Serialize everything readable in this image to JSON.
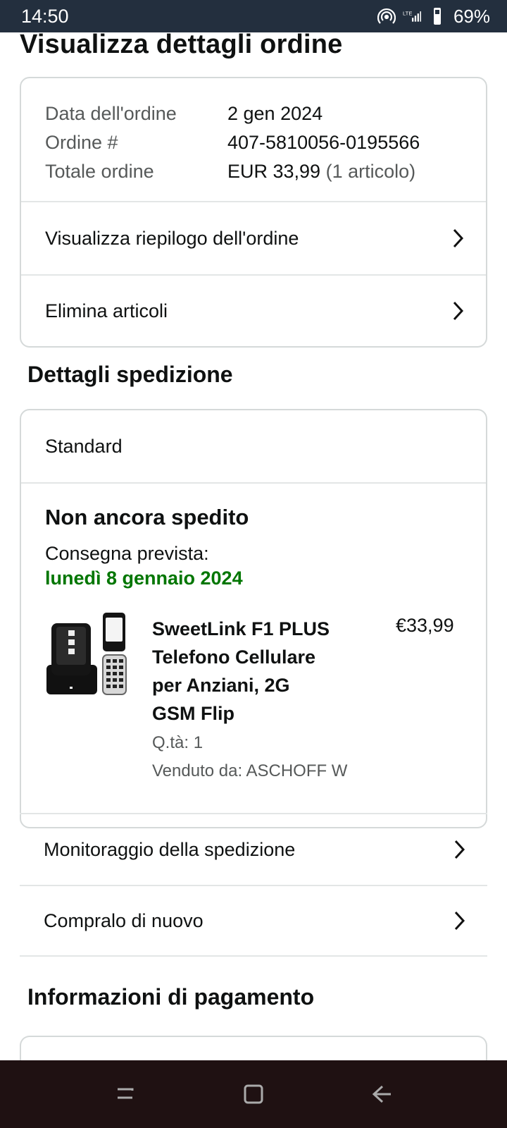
{
  "status_bar": {
    "time": "14:50",
    "battery": "69%",
    "icons": [
      "hotspot-icon",
      "lte-signal-icon",
      "battery-icon"
    ]
  },
  "page": {
    "title": "Visualizza dettagli ordine"
  },
  "order": {
    "date_label": "Data dell'ordine",
    "date_value": "2 gen 2024",
    "number_label": "Ordine #",
    "number_value": "407-5810056-0195566",
    "total_label": "Totale ordine",
    "total_value": "EUR 33,99",
    "total_note": "(1 articolo)",
    "summary_link": "Visualizza riepilogo dell'ordine",
    "delete_link": "Elimina articoli"
  },
  "shipping": {
    "section_title": "Dettagli spedizione",
    "method": "Standard",
    "status": "Non ancora spedito",
    "delivery_label": "Consegna prevista:",
    "delivery_date": "lunedì 8 gennaio 2024",
    "delivery_color": "#007600",
    "product": {
      "title_lines": [
        "SweetLink F1 PLUS",
        "Telefono Cellulare",
        "per Anziani, 2G",
        "GSM Flip"
      ],
      "price": "€33,99",
      "quantity": "Q.tà: 1",
      "seller": "Venduto da: ASCHOFF W"
    },
    "tracking_link": "Monitoraggio della spedizione",
    "buy_again_link": "Compralo di nuovo"
  },
  "payment": {
    "section_title": "Informazioni di pagamento"
  },
  "navigation": {
    "recent_apps": "recent-apps-icon",
    "home": "home-icon",
    "back": "back-icon"
  },
  "colors": {
    "status_bar": "#232f3e",
    "accent_green": "#007600",
    "border": "#d5d9d9",
    "nav_bar": "#1f1112"
  }
}
